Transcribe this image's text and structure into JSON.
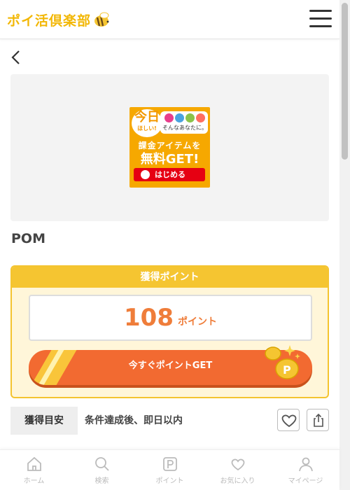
{
  "header": {
    "logo_text": "ポイ活倶楽部",
    "logo_icon": "bee-icon",
    "menu_icon": "hamburger-menu-icon"
  },
  "back_icon": "chevron-left-icon",
  "banner": {
    "today": "今日",
    "today_sub": "ほしい!",
    "bubble_caption": "そんなあなたに。",
    "line1": "課金アイテムを",
    "line2": "無料GET!",
    "cta": "はじめる"
  },
  "offer": {
    "title": "POM"
  },
  "points": {
    "header": "獲得ポイント",
    "value": "108",
    "unit": "ポイント",
    "get_button": "今すぐポイントGET"
  },
  "estimate": {
    "label": "獲得目安",
    "text": "条件達成後、即日以内",
    "favorite_icon": "heart-icon",
    "share_icon": "share-icon"
  },
  "bottom_nav": {
    "items": [
      {
        "label": "ホーム",
        "icon": "home-icon"
      },
      {
        "label": "検索",
        "icon": "search-icon"
      },
      {
        "label": "ポイント",
        "icon": "point-icon"
      },
      {
        "label": "お気に入り",
        "icon": "heart-icon"
      },
      {
        "label": "マイページ",
        "icon": "person-icon"
      }
    ]
  },
  "colors": {
    "brand_yellow": "#f5c531",
    "accent_orange": "#f26a31",
    "points_text": "#ef7d3a"
  }
}
